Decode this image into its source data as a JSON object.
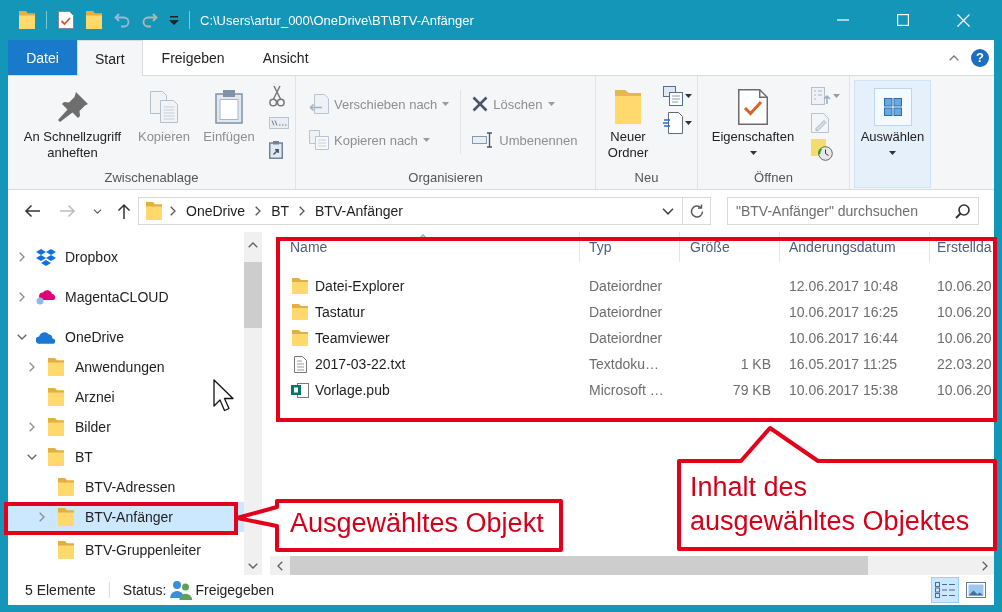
{
  "window": {
    "title": "C:\\Users\\artur_000\\OneDrive\\BT\\BTV-Anfänger"
  },
  "ribbon_tabs": [
    {
      "label": "Datei",
      "kind": "file",
      "selected": false
    },
    {
      "label": "Start",
      "kind": "tab",
      "selected": true
    },
    {
      "label": "Freigeben",
      "kind": "tab",
      "selected": false
    },
    {
      "label": "Ansicht",
      "kind": "tab",
      "selected": false
    }
  ],
  "help_button": "?",
  "ribbon_groups": [
    {
      "label": "Zwischenablage",
      "buttons": [
        {
          "label": "An Schnellzugriff anheften",
          "kind": "large",
          "disabled": false,
          "dropdown": false,
          "highlighted": false
        },
        {
          "label": "Kopieren",
          "kind": "large",
          "disabled": true,
          "dropdown": false,
          "highlighted": false
        },
        {
          "label": "Einfügen",
          "kind": "large",
          "disabled": true,
          "dropdown": false,
          "highlighted": false
        }
      ]
    },
    {
      "label": "Organisieren",
      "buttons": [
        {
          "label": "Verschieben nach",
          "kind": "small",
          "disabled": true,
          "dropdown": true,
          "highlighted": false
        },
        {
          "label": "Löschen",
          "kind": "small",
          "disabled": true,
          "dropdown": true,
          "highlighted": false
        },
        {
          "label": "Kopieren nach",
          "kind": "small",
          "disabled": true,
          "dropdown": true,
          "highlighted": false
        },
        {
          "label": "Umbenennen",
          "kind": "small",
          "disabled": true,
          "dropdown": false,
          "highlighted": false
        }
      ]
    },
    {
      "label": "Neu",
      "buttons": [
        {
          "label": "Neuer Ordner",
          "kind": "large",
          "disabled": false,
          "dropdown": false,
          "highlighted": false
        }
      ]
    },
    {
      "label": "Öffnen",
      "buttons": [
        {
          "label": "Eigenschaften",
          "kind": "large",
          "disabled": false,
          "dropdown": true,
          "highlighted": false
        }
      ]
    },
    {
      "buttons": [
        {
          "label": "Auswählen",
          "kind": "large",
          "disabled": false,
          "dropdown": true,
          "highlighted": true
        }
      ]
    }
  ],
  "address_bar": {
    "back_disabled": false,
    "forward_disabled": true,
    "path": [
      "OneDrive",
      "BT",
      "BTV-Anfänger"
    ]
  },
  "search": {
    "placeholder": "\"BTV-Anfänger\" durchsuchen"
  },
  "navigation": [
    {
      "label": "Dropbox",
      "expandable": true,
      "expanded": false,
      "selected": false
    },
    {
      "label": "MagentaCLOUD",
      "expandable": true,
      "expanded": false,
      "selected": false
    },
    {
      "label": "OneDrive",
      "expandable": true,
      "expanded": true,
      "selected": false,
      "children": [
        {
          "label": "Anwendungen",
          "expandable": true,
          "expanded": false,
          "selected": false
        },
        {
          "label": "Arznei",
          "expandable": false,
          "expanded": false,
          "selected": false
        },
        {
          "label": "Bilder",
          "expandable": true,
          "expanded": false,
          "selected": false
        },
        {
          "label": "BT",
          "expandable": true,
          "expanded": true,
          "selected": false,
          "children": [
            {
              "label": "BTV-Adressen",
              "expandable": false,
              "expanded": false,
              "selected": false
            },
            {
              "label": "BTV-Anfänger",
              "expandable": true,
              "expanded": false,
              "selected": true
            },
            {
              "label": "BTV-Gruppenleiter",
              "expandable": false,
              "expanded": false,
              "selected": false
            }
          ]
        }
      ]
    }
  ],
  "file_list": {
    "columns": [
      {
        "label": "Name",
        "sorted": true
      },
      {
        "label": "Typ",
        "sorted": false
      },
      {
        "label": "Größe",
        "sorted": false
      },
      {
        "label": "Anderungsdatum",
        "sorted": false
      },
      {
        "label": "Erstellda",
        "sorted": false
      }
    ],
    "rows": [
      {
        "kind": "folder",
        "name": "Datei-Explorer",
        "type": "Dateiordner",
        "modified": "12.06.2017 10:48",
        "created": "10.06.20"
      },
      {
        "kind": "folder",
        "name": "Tastatur",
        "type": "Dateiordner",
        "modified": "10.06.2017 16:25",
        "created": "10.06.20"
      },
      {
        "kind": "folder",
        "name": "Teamviewer",
        "type": "Dateiordner",
        "modified": "10.06.2017 16:44",
        "created": "10.06.20"
      },
      {
        "kind": "text",
        "name": "2017-03-22.txt",
        "type": "Textdoku…",
        "size": "1 KB",
        "modified": "16.05.2017 11:25",
        "created": "22.03.20"
      },
      {
        "kind": "publication",
        "name": "Vorlage.pub",
        "type": "Microsoft …",
        "size": "79 KB",
        "modified": "10.06.2017 15:38",
        "created": "10.06.20"
      }
    ]
  },
  "status_bar": {
    "item_count": "5 Elemente",
    "status_label": "Status:",
    "status_value": "Freigegeben",
    "views": [
      {
        "kind": "details",
        "selected": true
      },
      {
        "kind": "thumbnails",
        "selected": false
      }
    ]
  },
  "callouts": [
    {
      "text": "Ausgewähltes Objekt"
    },
    {
      "text": "Inhalt des\nausgewähltes Objektes"
    }
  ]
}
